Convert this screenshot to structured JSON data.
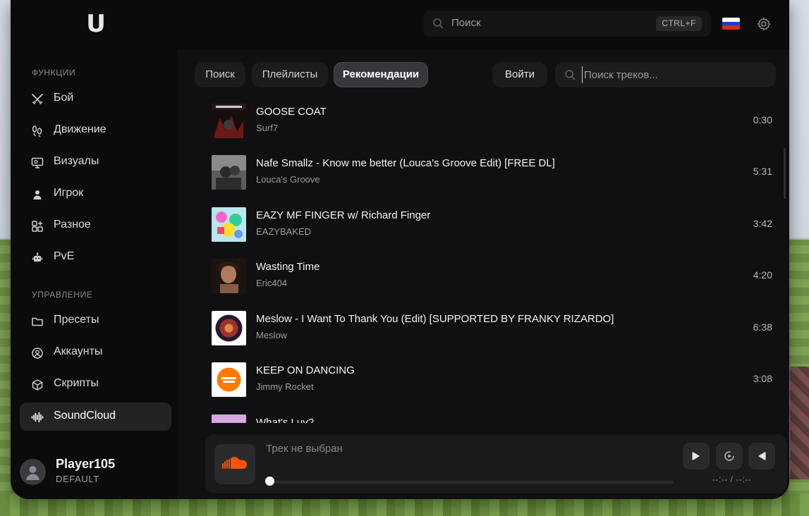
{
  "app": {
    "logo_letter": "U",
    "global_search": {
      "placeholder": "Поиск",
      "shortcut": "CTRL+F"
    },
    "language_flag": "ru-flag",
    "settings_icon": "gear-icon"
  },
  "sidebar": {
    "sections": [
      {
        "title": "ФУНКЦИИ"
      },
      {
        "title": "УПРАВЛЕНИЕ"
      }
    ],
    "items": [
      {
        "label": "Бой",
        "icon": "swords-icon"
      },
      {
        "label": "Движение",
        "icon": "footprints-icon"
      },
      {
        "label": "Визуалы",
        "icon": "monitor-icon"
      },
      {
        "label": "Игрок",
        "icon": "user-icon"
      },
      {
        "label": "Разное",
        "icon": "grid-plus-icon"
      },
      {
        "label": "PvE",
        "icon": "robot-icon"
      },
      {
        "label": "Пресеты",
        "icon": "folder-icon"
      },
      {
        "label": "Аккаунты",
        "icon": "user-circle-icon"
      },
      {
        "label": "Скрипты",
        "icon": "cube-icon"
      },
      {
        "label": "SoundCloud",
        "icon": "waveform-icon",
        "active": true
      }
    ],
    "user": {
      "name": "Player105",
      "role": "DEFAULT"
    }
  },
  "main": {
    "tabs": [
      {
        "label": "Поиск"
      },
      {
        "label": "Плейлисты"
      },
      {
        "label": "Рекомендации",
        "active": true
      }
    ],
    "login_label": "Войти",
    "track_search": {
      "placeholder": "Поиск треков...",
      "value": ""
    },
    "tracks": [
      {
        "title": "GOOSE COAT",
        "artist": "Surf7",
        "duration": "0:30"
      },
      {
        "title": "Nafe Smallz - Know me better (Louca's Groove Edit)  [FREE DL]",
        "artist": "Louca's Groove",
        "duration": "5:31"
      },
      {
        "title": "EAZY MF FINGER w/ Richard Finger",
        "artist": "EAZYBAKED",
        "duration": "3:42"
      },
      {
        "title": "Wasting Time",
        "artist": "Eric404",
        "duration": "4:20"
      },
      {
        "title": "Meslow - I Want To Thank You (Edit) [SUPPORTED BY FRANKY RIZARDO]",
        "artist": "Meslow",
        "duration": "6:38"
      },
      {
        "title": "KEEP ON DANCING",
        "artist": "Jimmy Rocket",
        "duration": "3:08"
      },
      {
        "title": "What's Luv?",
        "artist": "",
        "duration": ""
      }
    ]
  },
  "player": {
    "status": "Трек не выбран",
    "time": "--:-- / --:--",
    "progress": 0,
    "colors": {
      "soundcloud_orange": "#ff5500"
    }
  }
}
